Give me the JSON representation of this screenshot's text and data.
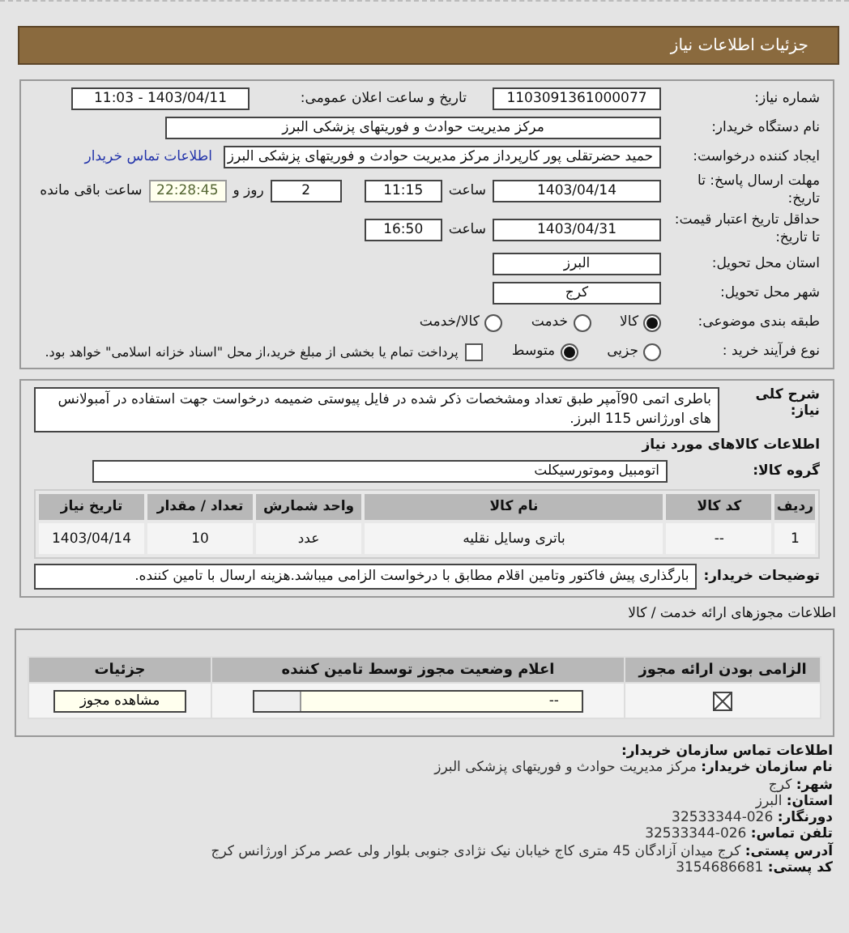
{
  "header": {
    "title": "جزئیات اطلاعات نیاز"
  },
  "details": {
    "need_number": {
      "label": "شماره نیاز:",
      "value": "1103091361000077"
    },
    "announce": {
      "label": "تاریخ و ساعت اعلان عمومی:",
      "value": "1403/04/11 - 11:03"
    },
    "buyer": {
      "label": "نام دستگاه خریدار:",
      "value": "مرکز مدیریت حوادث و فوریتهای پزشکی البرز"
    },
    "creator": {
      "label": "ایجاد کننده درخواست:",
      "value": "حمید حضرتقلی پور کارپرداز  مرکز مدیریت حوادث و فوریتهای پزشکی البرز",
      "link": "اطلاعات تماس خریدار"
    },
    "deadline": {
      "label": "مهلت ارسال پاسخ: تا تاریخ:",
      "date": "1403/04/14",
      "time_label": "ساعت",
      "time": "11:15",
      "days": "2",
      "days_label": "روز و",
      "remaining": "22:28:45",
      "remaining_label": "ساعت باقی مانده"
    },
    "validity": {
      "label": "حداقل تاریخ اعتبار قیمت: تا تاریخ:",
      "date": "1403/04/31",
      "time_label": "ساعت",
      "time": "16:50"
    },
    "province": {
      "label": "استان محل تحویل:",
      "value": "البرز"
    },
    "city": {
      "label": "شهر محل تحویل:",
      "value": "کرج"
    },
    "category": {
      "label": "طبقه بندی موضوعی:",
      "options": [
        {
          "label": "کالا",
          "selected": true
        },
        {
          "label": "خدمت",
          "selected": false
        },
        {
          "label": "کالا/خدمت",
          "selected": false
        }
      ]
    },
    "process": {
      "label": "نوع فرآیند خرید :",
      "options": [
        {
          "label": "جزیی",
          "selected": false
        },
        {
          "label": "متوسط",
          "selected": true
        }
      ],
      "treasury": {
        "label": "پرداخت تمام یا بخشی از مبلغ خرید،از محل \"اسناد خزانه اسلامی\" خواهد بود.",
        "checked": false
      }
    }
  },
  "goods": {
    "description_label": "شرح کلی نیاز:",
    "description": "باطری اتمی 90آمپر طبق تعداد ومشخصات ذکر شده در فایل پیوستی ضمیمه درخواست جهت استفاده در آمبولانس های اورژانس 115 البرز.",
    "section_title": "اطلاعات کالاهای مورد نیاز",
    "group_label": "گروه کالا:",
    "group": "اتومبیل وموتورسیکلت",
    "columns": [
      "ردیف",
      "کد کالا",
      "نام کالا",
      "واحد شمارش",
      "تعداد / مقدار",
      "تاریخ نیاز"
    ],
    "rows": [
      [
        "1",
        "--",
        "باتری وسایل نقلیه",
        "عدد",
        "10",
        "1403/04/14"
      ]
    ],
    "notes_label": "توضیحات خریدار:",
    "notes": "بارگذاری پیش فاکتور وتامین اقلام مطابق با درخواست الزامی میباشد.هزینه ارسال با تامین کننده."
  },
  "license": {
    "title": "اطلاعات مجوزهای ارائه خدمت / کالا",
    "columns": [
      "الزامی بودن ارائه مجوز",
      "اعلام وضعیت مجوز توسط تامین کننده",
      "جزئیات"
    ],
    "rows": [
      {
        "required": true,
        "status": "--",
        "button": "مشاهده مجوز"
      }
    ]
  },
  "contact": {
    "title": "اطلاعات تماس سازمان خریدار:",
    "fields": [
      {
        "label": "نام سازمان خریدار:",
        "value": "مرکز مدیریت حوادث و فوریتهای پزشکی البرز"
      },
      {
        "label": "شهر:",
        "value": "کرج"
      },
      {
        "label": "استان:",
        "value": "البرز"
      },
      {
        "label": "دورنگار:",
        "value": "026-32533344"
      },
      {
        "label": "تلفن تماس:",
        "value": "026-32533344"
      },
      {
        "label": "آدرس پستی:",
        "value": "کرج میدان آزادگان 45 متری کاج خیابان نیک نژادی جنوبی بلوار ولی عصر مرکز اورژانس کرج"
      },
      {
        "label": "کد پستی:",
        "value": "3154686681"
      }
    ]
  }
}
